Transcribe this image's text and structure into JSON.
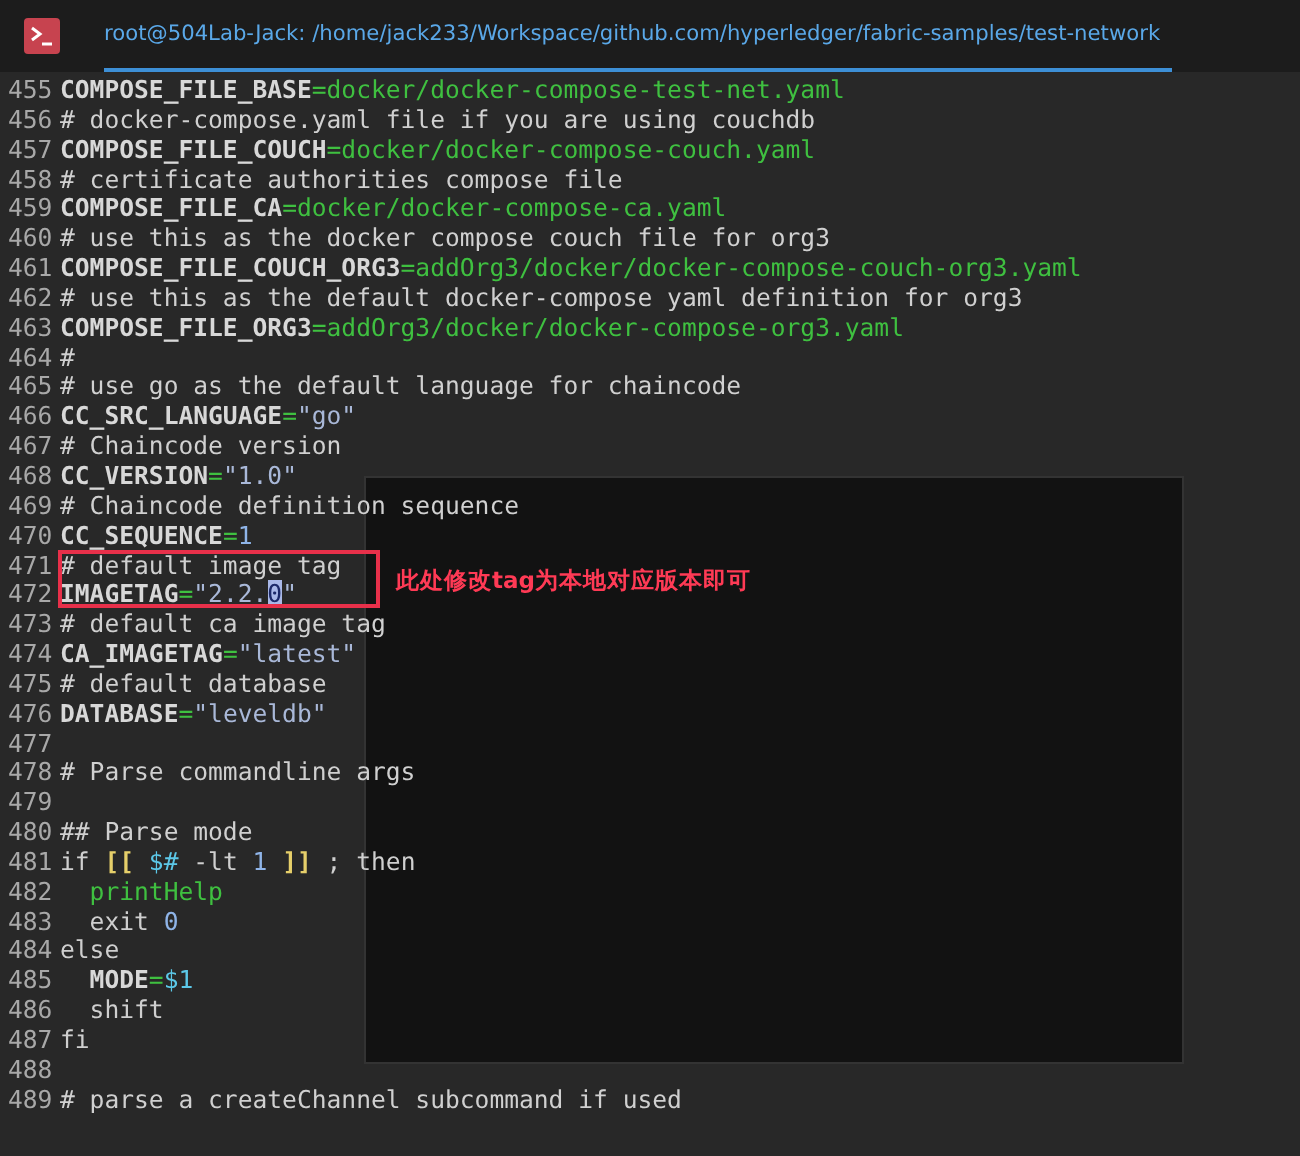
{
  "window": {
    "title": "root@504Lab-Jack: /home/jack233/Workspace/github.com/hyperledger/fabric-samples/test-network"
  },
  "annotation": {
    "text": "此处修改tag为本地对应版本即可"
  },
  "lines": [
    {
      "number": "455",
      "segments": [
        {
          "kind": "key",
          "text": "COMPOSE_FILE_BASE"
        },
        {
          "kind": "value",
          "text": "=docker/docker-compose-test-net.yaml"
        }
      ]
    },
    {
      "number": "456",
      "segments": [
        {
          "kind": "comment",
          "text": "# docker-compose.yaml file if you are using couchdb"
        }
      ]
    },
    {
      "number": "457",
      "segments": [
        {
          "kind": "key",
          "text": "COMPOSE_FILE_COUCH"
        },
        {
          "kind": "value",
          "text": "=docker/docker-compose-couch.yaml"
        }
      ]
    },
    {
      "number": "458",
      "segments": [
        {
          "kind": "comment",
          "text": "# certificate authorities compose file"
        }
      ]
    },
    {
      "number": "459",
      "segments": [
        {
          "kind": "key",
          "text": "COMPOSE_FILE_CA"
        },
        {
          "kind": "value",
          "text": "=docker/docker-compose-ca.yaml"
        }
      ]
    },
    {
      "number": "460",
      "segments": [
        {
          "kind": "comment",
          "text": "# use this as the docker compose couch file for org3"
        }
      ]
    },
    {
      "number": "461",
      "segments": [
        {
          "kind": "key",
          "text": "COMPOSE_FILE_COUCH_ORG3"
        },
        {
          "kind": "value",
          "text": "=addOrg3/docker/docker-compose-couch-org3.yaml"
        }
      ]
    },
    {
      "number": "462",
      "segments": [
        {
          "kind": "comment",
          "text": "# use this as the default docker-compose yaml definition for org3"
        }
      ]
    },
    {
      "number": "463",
      "segments": [
        {
          "kind": "key",
          "text": "COMPOSE_FILE_ORG3"
        },
        {
          "kind": "value",
          "text": "=addOrg3/docker/docker-compose-org3.yaml"
        }
      ]
    },
    {
      "number": "464",
      "segments": [
        {
          "kind": "comment",
          "text": "#"
        }
      ]
    },
    {
      "number": "465",
      "segments": [
        {
          "kind": "comment",
          "text": "# use go as the default language for chaincode"
        }
      ]
    },
    {
      "number": "466",
      "segments": [
        {
          "kind": "key",
          "text": "CC_SRC_LANGUAGE"
        },
        {
          "kind": "value",
          "text": "="
        },
        {
          "kind": "string",
          "text": "\"go\""
        }
      ]
    },
    {
      "number": "467",
      "segments": [
        {
          "kind": "comment",
          "text": "# Chaincode version"
        }
      ]
    },
    {
      "number": "468",
      "segments": [
        {
          "kind": "key",
          "text": "CC_VERSION"
        },
        {
          "kind": "value",
          "text": "="
        },
        {
          "kind": "string",
          "text": "\"1.0\""
        }
      ]
    },
    {
      "number": "469",
      "segments": [
        {
          "kind": "comment",
          "text": "# Chaincode definition sequence"
        }
      ]
    },
    {
      "number": "470",
      "segments": [
        {
          "kind": "key",
          "text": "CC_SEQUENCE"
        },
        {
          "kind": "value",
          "text": "="
        },
        {
          "kind": "number",
          "text": "1"
        }
      ]
    },
    {
      "number": "471",
      "boxed": true,
      "segments": [
        {
          "kind": "comment",
          "text": "# default image tag"
        }
      ]
    },
    {
      "number": "472",
      "boxed": true,
      "segments": [
        {
          "kind": "key",
          "text": "IMAGETAG"
        },
        {
          "kind": "value",
          "text": "="
        },
        {
          "kind": "string",
          "text": "\"2.2."
        },
        {
          "kind": "cursor",
          "text": "0"
        },
        {
          "kind": "string",
          "text": "\""
        }
      ]
    },
    {
      "number": "473",
      "segments": [
        {
          "kind": "comment",
          "text": "# default ca image tag"
        }
      ]
    },
    {
      "number": "474",
      "segments": [
        {
          "kind": "key",
          "text": "CA_IMAGETAG"
        },
        {
          "kind": "value",
          "text": "="
        },
        {
          "kind": "string",
          "text": "\"latest\""
        }
      ]
    },
    {
      "number": "475",
      "segments": [
        {
          "kind": "comment",
          "text": "# default database"
        }
      ]
    },
    {
      "number": "476",
      "segments": [
        {
          "kind": "key",
          "text": "DATABASE"
        },
        {
          "kind": "value",
          "text": "="
        },
        {
          "kind": "string",
          "text": "\"leveldb\""
        }
      ]
    },
    {
      "number": "477"
    },
    {
      "number": "478",
      "segments": [
        {
          "kind": "comment",
          "text": "# Parse commandline args"
        }
      ]
    },
    {
      "number": "479"
    },
    {
      "number": "480",
      "segments": [
        {
          "kind": "comment",
          "text": "## Parse mode"
        }
      ]
    },
    {
      "number": "481",
      "segments": [
        {
          "kind": "plain",
          "text": "if "
        },
        {
          "kind": "bracket",
          "text": "[["
        },
        {
          "kind": "variable",
          "text": " $#"
        },
        {
          "kind": "plain",
          "text": " -lt "
        },
        {
          "kind": "number",
          "text": "1 "
        },
        {
          "kind": "bracket",
          "text": "]]"
        },
        {
          "kind": "plain",
          "text": " ; then"
        }
      ]
    },
    {
      "number": "482",
      "segments": [
        {
          "kind": "function",
          "text": "  printHelp"
        }
      ]
    },
    {
      "number": "483",
      "segments": [
        {
          "kind": "plain",
          "text": "  exit "
        },
        {
          "kind": "number",
          "text": "0"
        }
      ]
    },
    {
      "number": "484",
      "segments": [
        {
          "kind": "plain",
          "text": "else"
        }
      ]
    },
    {
      "number": "485",
      "segments": [
        {
          "kind": "key",
          "text": "  MODE"
        },
        {
          "kind": "value",
          "text": "="
        },
        {
          "kind": "variable",
          "text": "$1"
        }
      ]
    },
    {
      "number": "486",
      "segments": [
        {
          "kind": "plain",
          "text": "  shift"
        }
      ]
    },
    {
      "number": "487",
      "segments": [
        {
          "kind": "plain",
          "text": "fi"
        }
      ]
    },
    {
      "number": "488"
    },
    {
      "number": "489",
      "segments": [
        {
          "kind": "comment",
          "text": "# parse a createChannel subcommand if used"
        }
      ]
    }
  ]
}
